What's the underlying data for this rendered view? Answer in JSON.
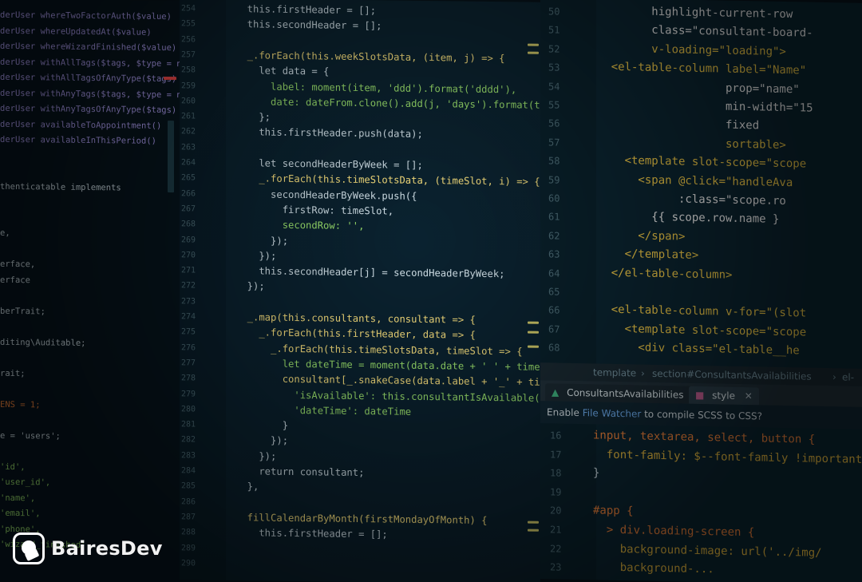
{
  "brand": {
    "name": "BairesDev"
  },
  "left_pane": {
    "lines": [
      {
        "text": "derUser whereTwoFactorAuth($value)",
        "cls": "purple"
      },
      {
        "text": "derUser whereUpdatedAt($value)",
        "cls": "purple"
      },
      {
        "text": "derUser whereWizardFinished($value)",
        "cls": "purple"
      },
      {
        "text": "derUser withAllTags($tags, $type = null)",
        "cls": "purple"
      },
      {
        "text": "derUser withAllTagsOfAnyType($tags)",
        "cls": "purple"
      },
      {
        "text": "derUser withAnyTags($tags, $type = null)",
        "cls": "purple"
      },
      {
        "text": "derUser withAnyTagsOfAnyType($tags)",
        "cls": "purple"
      },
      {
        "text": "derUser availableToAppointment()",
        "cls": "purple"
      },
      {
        "text": "derUser availableInThisPeriod()",
        "cls": "purple"
      },
      {
        "text": "",
        "cls": "pl"
      },
      {
        "text": "",
        "cls": "pl"
      },
      {
        "text": "thenticatable implements",
        "cls": "pl"
      },
      {
        "text": "",
        "cls": "pl"
      },
      {
        "text": "",
        "cls": "pl"
      },
      {
        "text": "e,",
        "cls": "pl"
      },
      {
        "text": "",
        "cls": "pl"
      },
      {
        "text": "erface,",
        "cls": "pl"
      },
      {
        "text": "erface",
        "cls": "pl"
      },
      {
        "text": "",
        "cls": "pl"
      },
      {
        "text": "berTrait;",
        "cls": "pl"
      },
      {
        "text": "",
        "cls": "pl"
      },
      {
        "text": "diting\\Auditable;",
        "cls": "pl"
      },
      {
        "text": "",
        "cls": "pl"
      },
      {
        "text": "rait;",
        "cls": "pl"
      },
      {
        "text": "",
        "cls": "pl"
      },
      {
        "text": "ENS = 1;",
        "cls": "orange"
      },
      {
        "text": "",
        "cls": "pl"
      },
      {
        "text": "e = 'users';",
        "cls": "pl"
      },
      {
        "text": "",
        "cls": "pl"
      },
      {
        "text": "'id',",
        "cls": "str"
      },
      {
        "text": "'user_id',",
        "cls": "str"
      },
      {
        "text": "'name',",
        "cls": "str"
      },
      {
        "text": "'email',",
        "cls": "str"
      },
      {
        "text": "'phone',",
        "cls": "str"
      },
      {
        "text": "'wizard_finished',",
        "cls": "str"
      }
    ]
  },
  "middle_pane": {
    "line_numbers": [
      "254",
      "255",
      "256",
      "257",
      "258",
      "259",
      "260",
      "261",
      "262",
      "263",
      "264",
      "265",
      "266",
      "267",
      "268",
      "269",
      "270",
      "271",
      "272",
      "273",
      "274",
      "275",
      "276",
      "277",
      "278",
      "279",
      "280",
      "281",
      "282",
      "283",
      "284",
      "285",
      "286",
      "287",
      "288",
      "289",
      "290"
    ],
    "code": [
      "  this.firstHeader = [];",
      "  this.secondHeader = [];",
      "",
      "  _.forEach(this.weekSlotsData, (item, j) => {",
      "    let data = {",
      "      label: moment(item, 'ddd').format('dddd'),",
      "      date: dateFrom.clone().add(j, 'days').format(this.f",
      "    };",
      "    this.firstHeader.push(data);",
      "",
      "    let secondHeaderByWeek = [];",
      "    _.forEach(this.timeSlotsData, (timeSlot, i) => {",
      "      secondHeaderByWeek.push({",
      "        firstRow: timeSlot,",
      "        secondRow: '',",
      "      });",
      "    });",
      "    this.secondHeader[j] = secondHeaderByWeek;",
      "  });",
      "",
      "  _.map(this.consultants, consultant => {",
      "    _.forEach(this.firstHeader, data => {",
      "      _.forEach(this.timeSlotsData, timeSlot => {",
      "        let dateTime = moment(data.date + ' ' + timeSlo",
      "        consultant[_.snakeCase(data.label + '_' + timeSl",
      "          'isAvailable': this.consultantIsAvailable(co",
      "          'dateTime': dateTime",
      "        }",
      "      });",
      "    });",
      "    return consultant;",
      "  },",
      "",
      "  fillCalendarByMonth(firstMondayOfMonth) {",
      "    this.firstHeader = [];"
    ]
  },
  "right_pane": {
    "line_numbers": [
      "50",
      "51",
      "52",
      "53",
      "54",
      "55",
      "56",
      "57",
      "58",
      "59",
      "60",
      "61",
      "62",
      "63",
      "64",
      "65",
      "66",
      "67",
      "68"
    ],
    "template_lines": [
      "          highlight-current-row",
      "          class=\"consultant-board-",
      "          v-loading=\"loading\">",
      "    <el-table-column label=\"Name\"",
      "                     prop=\"name\"",
      "                     min-width=\"15",
      "                     fixed",
      "                     sortable>",
      "      <template slot-scope=\"scope",
      "        <span @click=\"handleAva",
      "              :class=\"scope.ro",
      "          {{ scope.row.name }",
      "        </span>",
      "      </template>",
      "    </el-table-column>",
      "",
      "    <el-table-column v-for=\"(slot",
      "      <template slot-scope=\"scope",
      "        <div class=\"el-table__he"
    ],
    "breadcrumb": [
      "template",
      "›",
      "section#ConsultantsAvailabilities",
      "›",
      "el-tal"
    ],
    "tabs": [
      {
        "label": "ConsultantsAvailabilities",
        "active": true,
        "icon": "vue-file-icon"
      },
      {
        "label": "style",
        "active": false,
        "icon": "sass-file-icon"
      }
    ],
    "notification": {
      "prefix": "Enable ",
      "link": "File Watcher",
      "suffix": " to compile SCSS to CSS?"
    },
    "scss_line_numbers": [
      "16",
      "17",
      "18",
      "19",
      "20",
      "21",
      "22",
      "23"
    ],
    "scss_lines": [
      "input, textarea, select, button {",
      "  font-family: $--font-family !important;",
      "}",
      "",
      "#app {",
      "  > div.loading-screen {",
      "    background-image: url('../img/",
      "    background-..."
    ]
  }
}
